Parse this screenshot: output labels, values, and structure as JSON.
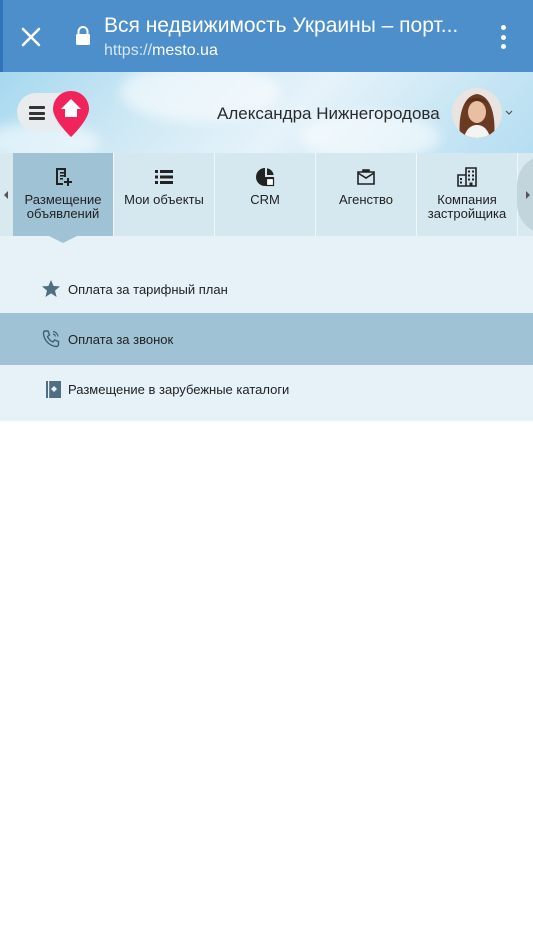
{
  "browser": {
    "title": "Вся недвижимость Украины – порт...",
    "url_scheme": "https://",
    "url_host": "mesto.ua"
  },
  "header": {
    "user_name": "Александра Нижнегородова"
  },
  "tabs": [
    {
      "label": "Размещение объявлений",
      "icon": "document-add-icon",
      "active": true
    },
    {
      "label": "Мои объекты",
      "icon": "list-icon",
      "active": false
    },
    {
      "label": "CRM",
      "icon": "pie-chart-icon",
      "active": false
    },
    {
      "label": "Агенство",
      "icon": "briefcase-icon",
      "active": false
    },
    {
      "label": "Компания застройщика",
      "icon": "building-icon",
      "active": false
    }
  ],
  "submenu": [
    {
      "label": "Оплата за тарифный план",
      "icon": "star-icon",
      "selected": false
    },
    {
      "label": "Оплата за звонок",
      "icon": "phone-icon",
      "selected": true
    },
    {
      "label": "Размещение в зарубежные каталоги",
      "icon": "catalog-icon",
      "selected": false
    }
  ],
  "colors": {
    "browser_bar": "#4d8fca",
    "active_tab": "#9fc3d5",
    "logo_pin": "#f0245a"
  }
}
